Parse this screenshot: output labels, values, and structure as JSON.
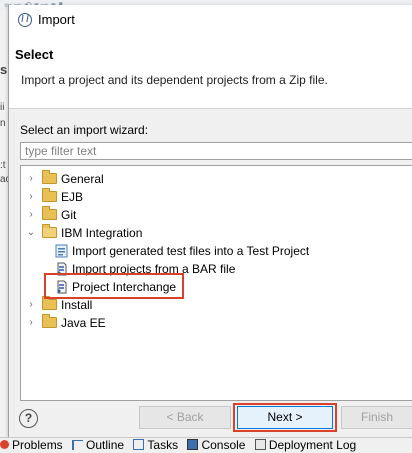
{
  "dialog": {
    "window_title": "Import",
    "app_icon": "eclipse-icon",
    "header_title": "Select",
    "header_description": "Import a project and its dependent projects from a Zip file.",
    "wizard_label": "Select an import wizard:",
    "filter_placeholder": "type filter text",
    "tree": [
      {
        "label": "General",
        "expanded": false,
        "icon": "folder-icon"
      },
      {
        "label": "EJB",
        "expanded": false,
        "icon": "folder-icon"
      },
      {
        "label": "Git",
        "expanded": false,
        "icon": "folder-icon"
      },
      {
        "label": "IBM Integration",
        "expanded": true,
        "icon": "folder-open-icon",
        "children": [
          {
            "label": "Import generated test files into a Test Project",
            "icon": "test-import-icon"
          },
          {
            "label": "Import projects from a BAR file",
            "icon": "bar-file-icon"
          },
          {
            "label": "Project Interchange",
            "icon": "project-interchange-icon",
            "highlighted": true
          }
        ]
      },
      {
        "label": "Install",
        "expanded": false,
        "icon": "folder-icon"
      },
      {
        "label": "Java EE",
        "expanded": false,
        "icon": "folder-icon"
      }
    ],
    "buttons": {
      "help": "?",
      "back": "< Back",
      "next": "Next >",
      "finish": "Finish"
    },
    "highlight_color": "#d9412a"
  },
  "statusbar": {
    "tabs": [
      {
        "label": "Problems",
        "icon": "problems-icon"
      },
      {
        "label": "Outline",
        "icon": "outline-icon"
      },
      {
        "label": "Tasks",
        "icon": "tasks-icon"
      },
      {
        "label": "Console",
        "icon": "console-icon"
      },
      {
        "label": "Deployment Log",
        "icon": "deployment-log-icon"
      }
    ]
  }
}
